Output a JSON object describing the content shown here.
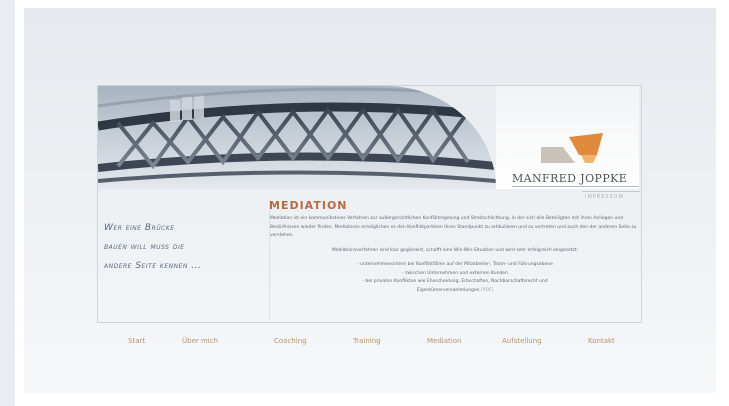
{
  "header": {
    "brand_name": "MANFRED JOPPKE",
    "impressum_label": "IMPRESSUM"
  },
  "quote": {
    "line1": "Wer eine Brücke",
    "line2": "bauen will muss die",
    "line3": "andere Seite kennen ..."
  },
  "content": {
    "heading": "MEDIATION",
    "intro": "Mediation ist ein kommunikatives Verfahren zur außergerichtlichen Konfliktregelung und Streitschlichtung, in der sich alle Beteiligten mit ihren Anliegen und Bedürfnissen wieder finden. Mediatoren ermöglichen es den Konfliktparteien ihren Standpunkt zu artikulieren und zu vertreten und auch den der anderen Seite zu verstehen.",
    "summary": "Mediationsverfahren sind klar gegliedert, schafft eine Win-Win-Situation und wird sehr erfolgreich eingesetzt:",
    "bullets": [
      "- unternehmensintern bei Konfliktfällen auf der Mitarbeiter-, Team- und Führungsebene",
      "- zwischen Unternehmen und externen Kunden",
      "- bei privaten Konflikten wie Ehescheidung, Erbschaften, Nachbarschaftsrecht und",
      "Eigentümerversammlungen"
    ],
    "pdf_label": "[PDF]"
  },
  "nav": {
    "items": [
      "Start",
      "Über mich",
      "Coaching",
      "Training",
      "Mediation",
      "Aufstellung",
      "Kontakt"
    ]
  },
  "colors": {
    "accent_orange": "#e08a3e",
    "heading_color": "#b46c44",
    "nav_color": "#b8936e",
    "quote_color": "#5a6a7a"
  }
}
